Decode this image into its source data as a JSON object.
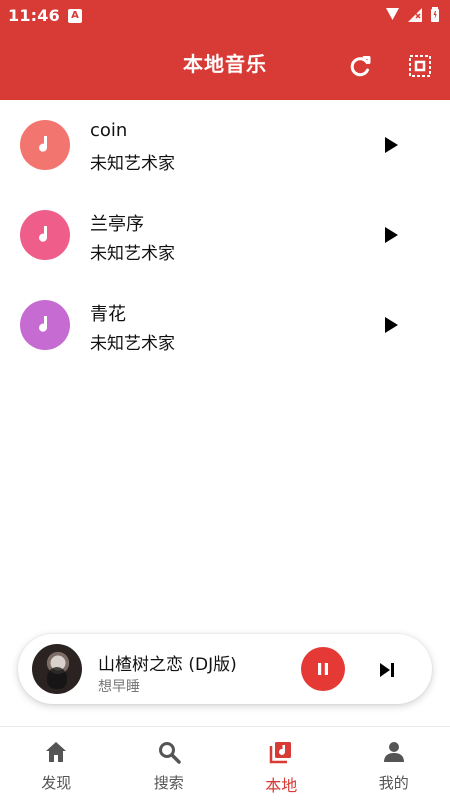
{
  "status_bar": {
    "time": "11:46",
    "badge": "A"
  },
  "app_bar": {
    "title": "本地音乐",
    "refresh_icon": "refresh-icon",
    "select_icon": "select-all-icon"
  },
  "colors": {
    "primary": "#d83b35",
    "avatar_1": "#f27570",
    "avatar_2": "#ef5e8b",
    "avatar_3": "#c66bd2",
    "accent": "#e53935"
  },
  "songs": [
    {
      "title": "coin",
      "artist": "未知艺术家",
      "avatar_color": "#f27570"
    },
    {
      "title": "兰亭序",
      "artist": "未知艺术家",
      "avatar_color": "#ef5e8b"
    },
    {
      "title": "青花",
      "artist": "未知艺术家",
      "avatar_color": "#c66bd2"
    }
  ],
  "mini_player": {
    "title": "山楂树之恋 (DJ版)",
    "artist": "想早睡"
  },
  "bottom_nav": {
    "items": [
      {
        "label": "发现",
        "icon": "home-icon"
      },
      {
        "label": "搜索",
        "icon": "search-icon"
      },
      {
        "label": "本地",
        "icon": "music-library-icon",
        "active": true
      },
      {
        "label": "我的",
        "icon": "person-icon"
      }
    ]
  }
}
